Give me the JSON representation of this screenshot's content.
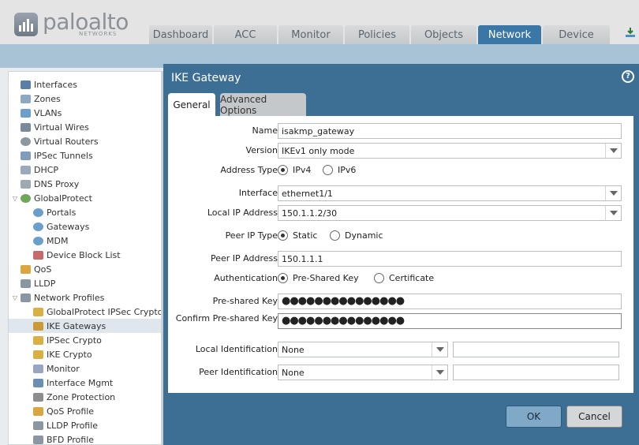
{
  "brand": {
    "word_a": "palo",
    "word_b": "alto",
    "sub": "NETWORKS"
  },
  "nav": {
    "tabs": [
      {
        "label": "Dashboard",
        "active": false
      },
      {
        "label": "ACC",
        "active": false
      },
      {
        "label": "Monitor",
        "active": false
      },
      {
        "label": "Policies",
        "active": false
      },
      {
        "label": "Objects",
        "active": false
      },
      {
        "label": "Network",
        "active": true
      },
      {
        "label": "Device",
        "active": false
      }
    ]
  },
  "tree": {
    "items": [
      {
        "label": "Interfaces",
        "icon": "interfaces-icon",
        "color": "#5a7fa5"
      },
      {
        "label": "Zones",
        "icon": "zones-icon",
        "color": "#8fa8c0"
      },
      {
        "label": "VLANs",
        "icon": "vlans-icon",
        "color": "#6ca0c8"
      },
      {
        "label": "Virtual Wires",
        "icon": "virtual-wires-icon",
        "color": "#7a8a99"
      },
      {
        "label": "Virtual Routers",
        "icon": "virtual-routers-icon",
        "color": "#8c97a2"
      },
      {
        "label": "IPSec Tunnels",
        "icon": "ipsec-tunnels-icon",
        "color": "#7f9db8"
      },
      {
        "label": "DHCP",
        "icon": "dhcp-icon",
        "color": "#9aaabb"
      },
      {
        "label": "DNS Proxy",
        "icon": "dns-proxy-icon",
        "color": "#a0a8b0"
      },
      {
        "label": "GlobalProtect",
        "icon": "globalprotect-icon",
        "color": "#6fa65a",
        "expanded": true
      },
      {
        "label": "Portals",
        "icon": "portals-icon",
        "color": "#6b9fcb"
      },
      {
        "label": "Gateways",
        "icon": "gateways-icon",
        "color": "#6b9fcb"
      },
      {
        "label": "MDM",
        "icon": "mdm-icon",
        "color": "#6b9fcb"
      },
      {
        "label": "Device Block List",
        "icon": "device-block-list-icon",
        "color": "#c96a6a"
      },
      {
        "label": "QoS",
        "icon": "qos-icon",
        "color": "#d9a640"
      },
      {
        "label": "LLDP",
        "icon": "lldp-icon",
        "color": "#8a96a2"
      },
      {
        "label": "Network Profiles",
        "icon": "network-profiles-icon",
        "color": "#8a96a2",
        "expanded": true
      },
      {
        "label": "GlobalProtect IPSec Crypto",
        "icon": "lock-icon",
        "color": "#d8b044"
      },
      {
        "label": "IKE Gateways",
        "icon": "ike-gateways-icon",
        "color": "#c89a3a",
        "selected": true
      },
      {
        "label": "IPSec Crypto",
        "icon": "lock-icon",
        "color": "#d8b044"
      },
      {
        "label": "IKE Crypto",
        "icon": "lock-icon",
        "color": "#d8b044"
      },
      {
        "label": "Monitor",
        "icon": "monitor-icon",
        "color": "#9aa6c0"
      },
      {
        "label": "Interface Mgmt",
        "icon": "interface-mgmt-icon",
        "color": "#6a8fb0"
      },
      {
        "label": "Zone Protection",
        "icon": "zone-protection-icon",
        "color": "#8d8d8d"
      },
      {
        "label": "QoS Profile",
        "icon": "qos-profile-icon",
        "color": "#d9a640"
      },
      {
        "label": "LLDP Profile",
        "icon": "lldp-profile-icon",
        "color": "#8a96a2"
      },
      {
        "label": "BFD Profile",
        "icon": "bfd-profile-icon",
        "color": "#8a96a2"
      }
    ]
  },
  "dialog": {
    "title": "IKE Gateway",
    "help": "?",
    "tabs": {
      "general": "General",
      "advanced": "Advanced Options"
    },
    "fields": {
      "name": {
        "label": "Name",
        "value": "isakmp_gateway"
      },
      "version": {
        "label": "Version",
        "value": "IKEv1 only mode"
      },
      "address_type": {
        "label": "Address Type",
        "opt1": "IPv4",
        "opt2": "IPv6",
        "selected": "IPv4"
      },
      "interface": {
        "label": "Interface",
        "value": "ethernet1/1"
      },
      "local_ip": {
        "label": "Local IP Address",
        "value": "150.1.1.2/30"
      },
      "peer_ip_type": {
        "label": "Peer IP Type",
        "opt1": "Static",
        "opt2": "Dynamic",
        "selected": "Static"
      },
      "peer_ip": {
        "label": "Peer IP Address",
        "value": "150.1.1.1"
      },
      "authentication": {
        "label": "Authentication",
        "opt1": "Pre-Shared Key",
        "opt2": "Certificate",
        "selected": "Pre-Shared Key"
      },
      "psk": {
        "label": "Pre-shared Key",
        "value": "●●●●●●●●●●●●●●●"
      },
      "confirm_psk": {
        "label": "Confirm Pre-shared Key",
        "value": "●●●●●●●●●●●●●●●"
      },
      "local_id": {
        "label": "Local Identification",
        "value": "None",
        "extra": ""
      },
      "peer_id": {
        "label": "Peer Identification",
        "value": "None",
        "extra": ""
      }
    },
    "buttons": {
      "ok": "OK",
      "cancel": "Cancel"
    }
  }
}
